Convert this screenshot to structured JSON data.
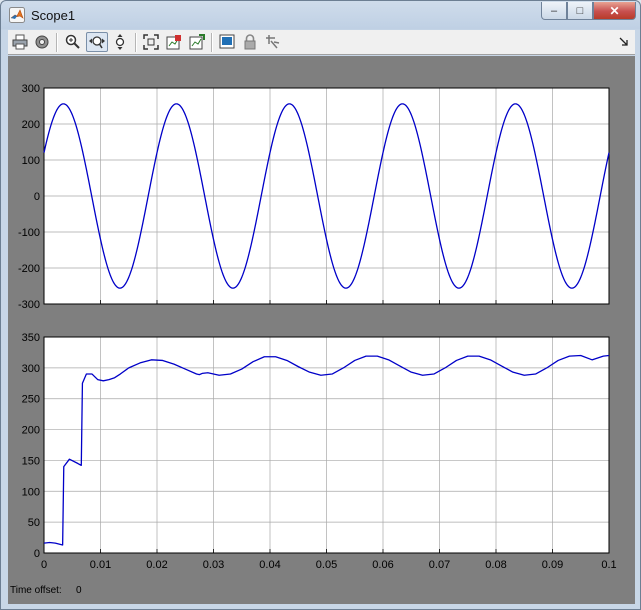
{
  "window": {
    "title": "Scope1",
    "controls": {
      "minimize": "–",
      "maximize": "□",
      "close": "✕"
    }
  },
  "toolbar": {
    "items": [
      {
        "name": "print-icon",
        "active": false
      },
      {
        "name": "parameters-gear-icon",
        "active": false
      },
      {
        "name": "zoom-icon",
        "active": false
      },
      {
        "name": "zoom-x-axis-icon",
        "active": true
      },
      {
        "name": "zoom-y-axis-icon",
        "active": false
      },
      {
        "name": "autoscale-icon",
        "active": false
      },
      {
        "name": "save-axes-settings-icon",
        "active": false
      },
      {
        "name": "restore-axes-settings-icon",
        "active": false
      },
      {
        "name": "floating-scope-icon",
        "active": false
      },
      {
        "name": "lock-axes-icon",
        "active": false
      },
      {
        "name": "signal-selection-icon",
        "active": false
      }
    ],
    "overflow_icon": "chevron-right-icon"
  },
  "footer": {
    "time_offset_label": "Time offset:",
    "time_offset_value": "0"
  },
  "colors": {
    "trace": "#0000c8",
    "axes_bg": "#ffffff",
    "frame": "#7f7f7f",
    "grid": "#a8a8a8"
  },
  "chart_data": [
    {
      "type": "line",
      "title": "",
      "xlabel": "",
      "ylabel": "",
      "xlim": [
        0,
        0.1
      ],
      "ylim": [
        -300,
        300
      ],
      "grid": true,
      "xticks": [
        0,
        0.01,
        0.02,
        0.03,
        0.04,
        0.05,
        0.06,
        0.07,
        0.08,
        0.09,
        0.1
      ],
      "xtick_labels_visible": false,
      "yticks": [
        300,
        200,
        100,
        0,
        -100,
        -200,
        -300
      ],
      "series": [
        {
          "x": [
            0,
            0.001,
            0.002,
            0.003,
            0.004,
            0.005,
            0.006,
            0.007,
            0.008,
            0.009,
            0.01,
            0.011,
            0.012,
            0.013,
            0.014,
            0.015,
            0.016,
            0.017,
            0.018,
            0.019,
            0.02,
            0.021,
            0.022,
            0.023,
            0.024,
            0.025,
            0.026,
            0.027,
            0.028,
            0.029,
            0.03,
            0.031,
            0.032,
            0.033,
            0.034,
            0.035,
            0.036,
            0.037,
            0.038,
            0.039,
            0.04,
            0.041,
            0.042,
            0.043,
            0.044,
            0.045,
            0.046,
            0.047,
            0.048,
            0.049,
            0.05,
            0.051,
            0.052,
            0.053,
            0.054,
            0.055,
            0.056,
            0.057,
            0.058,
            0.059,
            0.06,
            0.061,
            0.062,
            0.063,
            0.064,
            0.065,
            0.066,
            0.067,
            0.068,
            0.069,
            0.07,
            0.071,
            0.072,
            0.073,
            0.074,
            0.075,
            0.076,
            0.077,
            0.078,
            0.079,
            0.08,
            0.081,
            0.082,
            0.083,
            0.084,
            0.085,
            0.086,
            0.087,
            0.088,
            0.089,
            0.09,
            0.091,
            0.092,
            0.093,
            0.094,
            0.095,
            0.096,
            0.097,
            0.098,
            0.099,
            0.1
          ],
          "y": [
            121,
            192,
            238,
            256,
            242,
            199,
            132,
            50,
            -36,
            -116,
            -191,
            -238,
            -256,
            -242,
            -199,
            -132,
            -50,
            36,
            116,
            191,
            238,
            256,
            242,
            199,
            132,
            50,
            -36,
            -116,
            -191,
            -238,
            -256,
            -242,
            -199,
            -132,
            -50,
            36,
            116,
            191,
            238,
            256,
            242,
            199,
            132,
            50,
            -36,
            -116,
            -191,
            -238,
            -256,
            -242,
            -199,
            -132,
            -50,
            36,
            116,
            191,
            238,
            256,
            242,
            199,
            132,
            50,
            -36,
            -116,
            -191,
            -238,
            -256,
            -242,
            -199,
            -132,
            -50,
            36,
            116,
            191,
            238,
            256,
            242,
            199,
            132,
            50,
            -36,
            -116,
            -191,
            -238,
            -256,
            -242,
            -199,
            -132,
            -50,
            36,
            116,
            191,
            238,
            256,
            242,
            199,
            132,
            50,
            -36,
            -116,
            121
          ]
        }
      ]
    },
    {
      "type": "line",
      "title": "",
      "xlabel": "",
      "ylabel": "",
      "xlim": [
        0,
        0.1
      ],
      "ylim": [
        0,
        350
      ],
      "grid": true,
      "xticks": [
        0,
        0.01,
        0.02,
        0.03,
        0.04,
        0.05,
        0.06,
        0.07,
        0.08,
        0.09,
        0.1
      ],
      "xtick_labels": [
        "0",
        "0.01",
        "0.02",
        "0.03",
        "0.04",
        "0.05",
        "0.06",
        "0.07",
        "0.08",
        "0.09",
        "0.1"
      ],
      "yticks": [
        350,
        300,
        250,
        200,
        150,
        100,
        50,
        0
      ],
      "series": [
        {
          "x": [
            0,
            0.001,
            0.002,
            0.0033,
            0.0035,
            0.0045,
            0.006,
            0.0066,
            0.0068,
            0.0075,
            0.0085,
            0.0095,
            0.0105,
            0.0115,
            0.0125,
            0.0135,
            0.015,
            0.017,
            0.019,
            0.021,
            0.023,
            0.025,
            0.027,
            0.0275,
            0.028,
            0.029,
            0.031,
            0.033,
            0.035,
            0.037,
            0.039,
            0.041,
            0.043,
            0.045,
            0.047,
            0.049,
            0.051,
            0.053,
            0.055,
            0.057,
            0.059,
            0.061,
            0.063,
            0.065,
            0.067,
            0.069,
            0.071,
            0.073,
            0.075,
            0.077,
            0.079,
            0.081,
            0.083,
            0.085,
            0.087,
            0.089,
            0.091,
            0.093,
            0.095,
            0.097,
            0.099,
            0.1
          ],
          "y": [
            16,
            17,
            16,
            13,
            140,
            152,
            145,
            142,
            275,
            290,
            290,
            281,
            279,
            281,
            284,
            290,
            300,
            308,
            313,
            312,
            306,
            298,
            290,
            289,
            291,
            292,
            288,
            290,
            298,
            310,
            318,
            318,
            312,
            302,
            293,
            288,
            290,
            300,
            312,
            319,
            319,
            313,
            303,
            293,
            288,
            290,
            300,
            312,
            319,
            319,
            313,
            303,
            293,
            288,
            290,
            300,
            312,
            319,
            320,
            313,
            319,
            320
          ]
        }
      ]
    }
  ]
}
